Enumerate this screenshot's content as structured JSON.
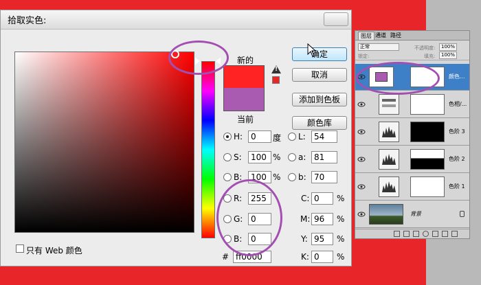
{
  "dialog": {
    "title": "拾取实色:",
    "labels": {
      "new": "新的",
      "current": "当前"
    },
    "buttons": {
      "ok": "确定",
      "cancel": "取消",
      "add_to_swatches": "添加到色板",
      "color_library": "颜色库"
    },
    "hsb": [
      {
        "label": "H:",
        "value": "0",
        "unit": "度",
        "selected": true
      },
      {
        "label": "S:",
        "value": "100",
        "unit": "%",
        "selected": false
      },
      {
        "label": "B:",
        "value": "100",
        "unit": "%",
        "selected": false
      }
    ],
    "rgb": [
      {
        "label": "R:",
        "value": "255"
      },
      {
        "label": "G:",
        "value": "0"
      },
      {
        "label": "B:",
        "value": "0"
      }
    ],
    "lab": [
      {
        "label": "L:",
        "value": "54"
      },
      {
        "label": "a:",
        "value": "81"
      },
      {
        "label": "b:",
        "value": "70"
      }
    ],
    "cmyk": [
      {
        "label": "C:",
        "value": "0",
        "unit": "%"
      },
      {
        "label": "M:",
        "value": "96",
        "unit": "%"
      },
      {
        "label": "Y:",
        "value": "95",
        "unit": "%"
      },
      {
        "label": "K:",
        "value": "0",
        "unit": "%"
      }
    ],
    "hex": {
      "label": "#",
      "value": "ff0000"
    },
    "web_only": {
      "label": "只有 Web 颜色",
      "checked": false
    },
    "new_color": "#ff2323",
    "current_color": "#a95bb2"
  },
  "layers_panel": {
    "tabs": [
      "图层",
      "通道",
      "路径"
    ],
    "blend_mode": "正常",
    "opacity_label": "不透明度:",
    "opacity": "100%",
    "lock_label": "锁定:",
    "fill_label": "填充:",
    "fill": "100%",
    "layers": [
      {
        "name": "颜色...",
        "selected": true
      },
      {
        "name": "色相/...",
        "selected": false
      },
      {
        "name": "色阶 3",
        "selected": false
      },
      {
        "name": "色阶 2",
        "selected": false
      },
      {
        "name": "色阶 1",
        "selected": false
      },
      {
        "name": "背景",
        "selected": false
      }
    ]
  },
  "colors": {
    "background": "#e8262a",
    "highlight": "#a24fb1",
    "selection": "#3d80c8"
  }
}
